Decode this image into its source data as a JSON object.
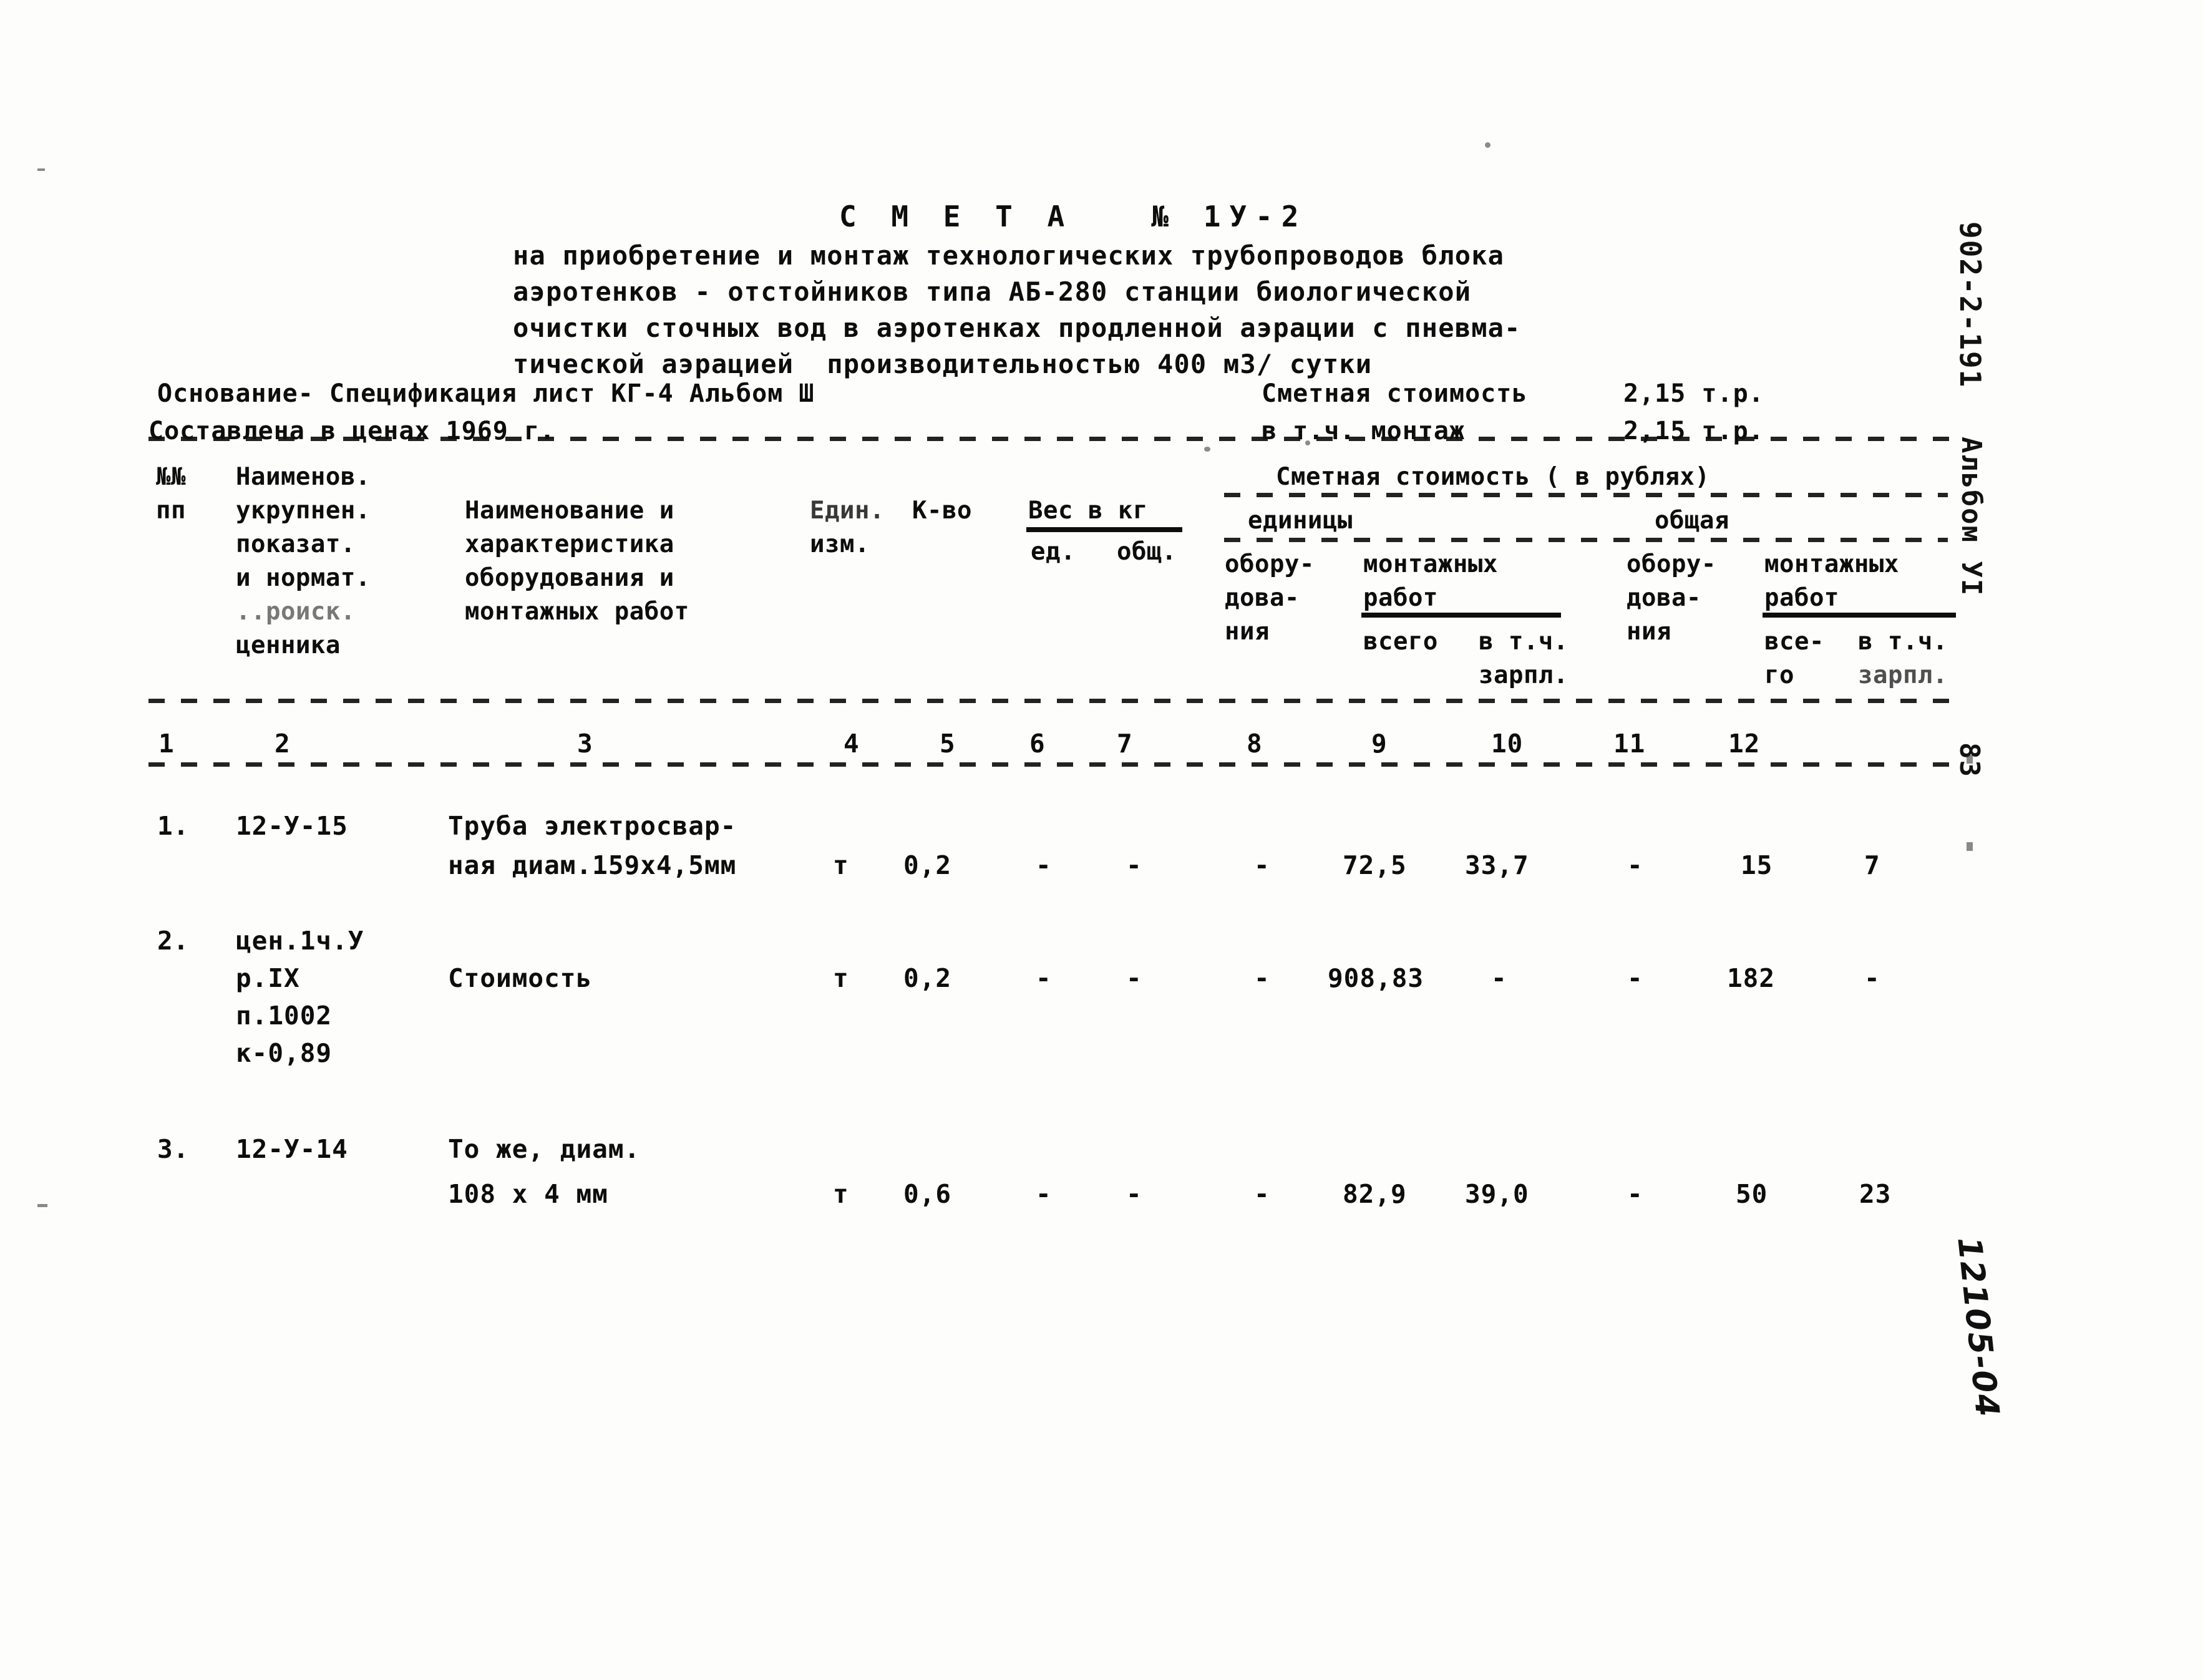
{
  "document": {
    "title_line": "С М Е Т А   № 1У-2",
    "subtitle_lines": [
      "на приобретение и монтаж технологических трубопроводов блока",
      "аэротенков - отстойников типа АБ-280 станции биологической",
      "очистки сточных вод в аэротенках продленной аэрации с пневма-",
      "тической аэрацией  производительностью 400 м3/ сутки"
    ],
    "basis_label": "Основание- Спецификация лист КГ-4 Альбом Ш",
    "prices_label": "Составлена в ценах 1969 г.",
    "total_cost_label": "Сметная стоимость",
    "total_cost_value": "2,15 т.р.",
    "installation_cost_label": "в т.ч. монтаж",
    "installation_cost_value": "2,15 т.р."
  },
  "margin": {
    "project_code": "902-2-191",
    "album": "Альбом УI",
    "page_number": "83",
    "stamp": "12105-04"
  },
  "table": {
    "headers": {
      "col1": [
        "№№",
        "пп"
      ],
      "col2": [
        "Наименов.",
        "укрупнен.",
        "показат.",
        "и нормат.",
        "..роиск.",
        "ценника"
      ],
      "col3": [
        "Наименование и",
        "характеристика",
        "оборудования и",
        "монтажных работ"
      ],
      "col4": [
        "Един.",
        "изм."
      ],
      "col5": [
        "К-во"
      ],
      "col6_group": "Вес в кг",
      "col6": "ед.",
      "col7": "общ.",
      "cost_group": "Сметная стоимость ( в рублях)",
      "unit_group": "единицы",
      "total_group": "общая",
      "col8": [
        "обору-",
        "дова-",
        "ния"
      ],
      "col9_group": [
        "монтажных",
        "работ"
      ],
      "col9": [
        "всего"
      ],
      "col10": [
        "в т.ч.",
        "зарпл."
      ],
      "col11": [
        "обору-",
        "дова-",
        "ния"
      ],
      "col12_group": [
        "монтажных",
        "работ"
      ],
      "col12a": [
        "все-",
        "го"
      ],
      "col12b": [
        "в т.ч.",
        "зарпл."
      ]
    },
    "column_numbers": [
      "1",
      "2",
      "3",
      "4",
      "5",
      "6",
      "7",
      "8",
      "9",
      "10",
      "11",
      "12"
    ],
    "rows": [
      {
        "num": "1.",
        "code_lines": [
          "12-У-15"
        ],
        "name_lines": [
          "Труба электросвар-",
          "ная диам.159х4,5мм"
        ],
        "unit": "т",
        "qty": "0,2",
        "weight_unit": "-",
        "weight_total": "-",
        "cost_unit_equip": "-",
        "cost_unit_install_total": "72,5",
        "cost_unit_install_wage": "33,7",
        "cost_total_equip": "-",
        "cost_total_install_total": "15",
        "cost_total_install_wage": "7"
      },
      {
        "num": "2.",
        "code_lines": [
          "цен.1ч.У",
          "р.IX",
          "п.1002",
          "к-0,89"
        ],
        "name_lines": [
          "Стоимость"
        ],
        "unit": "т",
        "qty": "0,2",
        "weight_unit": "-",
        "weight_total": "-",
        "cost_unit_equip": "-",
        "cost_unit_install_total": "908,83",
        "cost_unit_install_wage": "-",
        "cost_total_equip": "-",
        "cost_total_install_total": "182",
        "cost_total_install_wage": "-"
      },
      {
        "num": "3.",
        "code_lines": [
          "12-У-14"
        ],
        "name_lines": [
          "То же, диам.",
          "108 х 4 мм"
        ],
        "unit": "т",
        "qty": "0,6",
        "weight_unit": "-",
        "weight_total": "-",
        "cost_unit_equip": "-",
        "cost_unit_install_total": "82,9",
        "cost_unit_install_wage": "39,0",
        "cost_total_equip": "-",
        "cost_total_install_total": "50",
        "cost_total_install_wage": "23"
      }
    ]
  }
}
